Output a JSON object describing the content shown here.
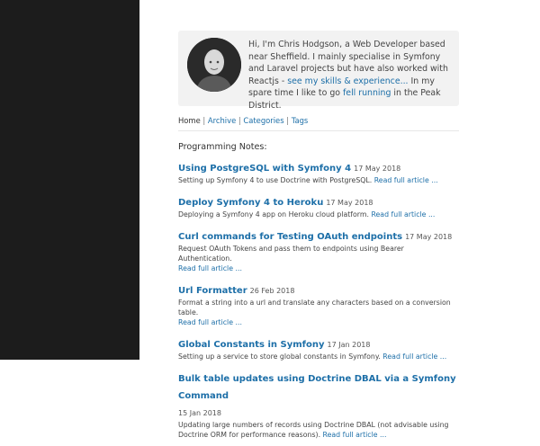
{
  "intro": {
    "text_1": "Hi, I'm Chris Hodgson, a Web Developer based near Sheffield. I mainly specialise in Symfony and Laravel projects but have also worked with Reactjs - ",
    "link_skills": "see my skills & experience...",
    "text_2": " In my spare time I like to go ",
    "link_running": "fell running",
    "text_3": " in the Peak District."
  },
  "nav": {
    "home": "Home",
    "archive": "Archive",
    "categories": "Categories",
    "tags": "Tags",
    "sep": "|"
  },
  "section_title": "Programming Notes:",
  "read_more": "Read full article ...",
  "posts": [
    {
      "title": "Using PostgreSQL with Symfony 4",
      "date": "17 May 2018",
      "desc": "Setting up Symfony 4 to use Doctrine with PostgreSQL."
    },
    {
      "title": "Deploy Symfony 4 to Heroku",
      "date": "17 May 2018",
      "desc": "Deploying a Symfony 4 app on Heroku cloud platform."
    },
    {
      "title": "Curl commands for Testing OAuth endpoints",
      "date": "17 May 2018",
      "desc": "Request OAuth Tokens and pass them to endpoints using Bearer Authentication."
    },
    {
      "title": "Url Formatter",
      "date": "26 Feb 2018",
      "desc": "Format a string into a url and translate any characters based on a conversion table."
    },
    {
      "title": "Global Constants in Symfony",
      "date": "17 Jan 2018",
      "desc": "Setting up a service to store global constants in Symfony."
    },
    {
      "title": "Bulk table updates using Doctrine DBAL via a Symfony Command",
      "date": "15 Jan 2018",
      "desc": "Updating large numbers of records using Doctrine DBAL (not advisable using Doctrine ORM for performance reasons)."
    }
  ]
}
